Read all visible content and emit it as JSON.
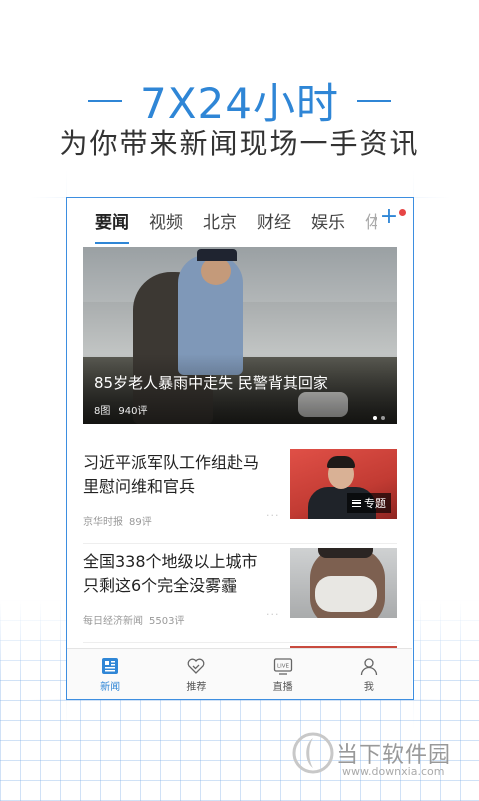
{
  "promo": {
    "headline": "7X24小时",
    "subline": "为你带来新闻现场一手资讯"
  },
  "tabs": [
    {
      "label": "要闻"
    },
    {
      "label": "视频"
    },
    {
      "label": "北京"
    },
    {
      "label": "财经"
    },
    {
      "label": "娱乐"
    },
    {
      "label": "体"
    }
  ],
  "hero": {
    "title": "85岁老人暴雨中走失 民警背其回家",
    "images": "8图",
    "comments": "940评"
  },
  "news": [
    {
      "title": "习近平派军队工作组赴马里慰问维和官兵",
      "source": "京华时报",
      "comments": "89评",
      "tag": "专题"
    },
    {
      "title": "全国338个地级以上城市只剩这6个完全没雾霾",
      "source": "每日经济新闻",
      "comments": "5503评"
    }
  ],
  "more_glyph": "···",
  "bottom_nav": [
    {
      "label": "新闻",
      "icon": "news-icon",
      "active": true
    },
    {
      "label": "推荐",
      "icon": "heart-icon",
      "active": false
    },
    {
      "label": "直播",
      "icon": "live-icon",
      "active": false
    },
    {
      "label": "我",
      "icon": "user-icon",
      "active": false
    }
  ],
  "live_icon_text": "LIVE",
  "brand": {
    "name": "当下软件园",
    "url": "www.downxia.com"
  },
  "colors": {
    "accent": "#2f86d6",
    "border": "#3d8ee0",
    "badge_red": "#e64545"
  }
}
